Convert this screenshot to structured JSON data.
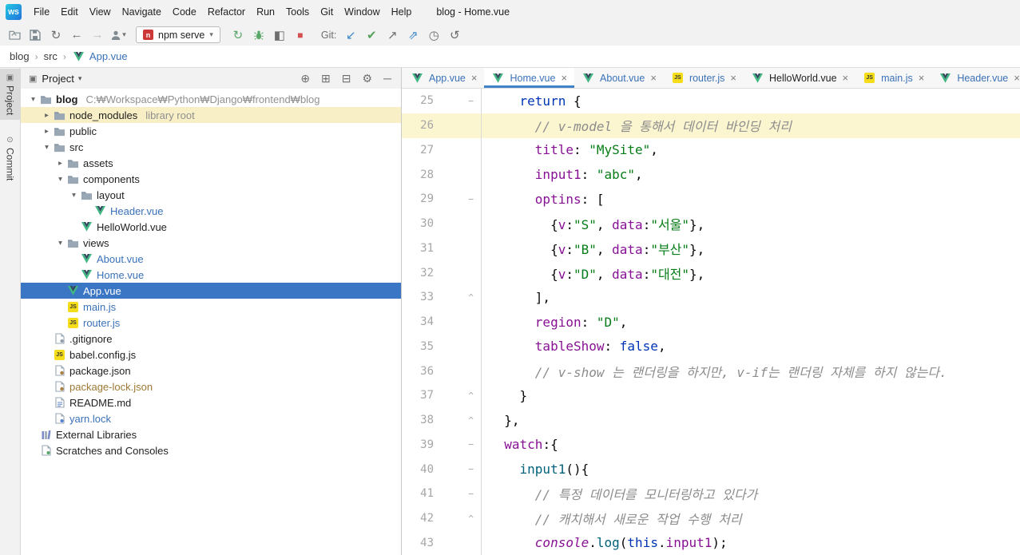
{
  "window": {
    "logo": "WS",
    "title": "blog - Home.vue"
  },
  "menu": {
    "items": [
      "File",
      "Edit",
      "View",
      "Navigate",
      "Code",
      "Refactor",
      "Run",
      "Tools",
      "Git",
      "Window",
      "Help"
    ]
  },
  "toolbar": {
    "run_config": "npm serve",
    "git_label": "Git:"
  },
  "icons": {
    "sync": "↻",
    "back": "←",
    "forward": "→",
    "dropdown": "▾",
    "npm": "n",
    "rerun": "↻",
    "profile": "◧",
    "stop": "■",
    "git_update": "↙",
    "git_commit": "✔",
    "git_push": "↗",
    "git_shelve": "⇗",
    "git_history": "◷",
    "git_rollback": "↺",
    "panel_icon": "▣",
    "commit_node": "⊙",
    "locate": "⊕",
    "expand_all": "⊞",
    "collapse_all": "⊟",
    "settings": "⚙",
    "hide": "─",
    "chevron_open": "▾",
    "chevron_closed": "▸",
    "breadcrumb_sep": "›",
    "tab_close": "×",
    "fold_start": "−",
    "fold_end": "^"
  },
  "breadcrumb": {
    "items": [
      {
        "label": "blog"
      },
      {
        "label": "src"
      },
      {
        "label": "App.vue",
        "icon": "vue",
        "modified": true
      }
    ]
  },
  "tool_strip": {
    "project": "Project",
    "commit": "Commit"
  },
  "project_panel": {
    "title": "Project",
    "tree": [
      {
        "label": "blog",
        "annotation": "C:₩Workspace₩Python₩Django₩frontend₩blog",
        "icon": "folder",
        "depth": 0,
        "chevron": "open",
        "bold": true
      },
      {
        "label": "node_modules",
        "annotation": "library root",
        "icon": "folder",
        "depth": 1,
        "chevron": "closed",
        "rowbg": "excluded"
      },
      {
        "label": "public",
        "icon": "folder",
        "depth": 1,
        "chevron": "closed"
      },
      {
        "label": "src",
        "icon": "folder",
        "depth": 1,
        "chevron": "open"
      },
      {
        "label": "assets",
        "icon": "folder",
        "depth": 2,
        "chevron": "closed"
      },
      {
        "label": "components",
        "icon": "folder",
        "depth": 2,
        "chevron": "open"
      },
      {
        "label": "layout",
        "icon": "folder",
        "depth": 3,
        "chevron": "open"
      },
      {
        "label": "Header.vue",
        "icon": "vue",
        "depth": 4,
        "color": "modified"
      },
      {
        "label": "HelloWorld.vue",
        "icon": "vue",
        "depth": 3
      },
      {
        "label": "views",
        "icon": "folder",
        "depth": 2,
        "chevron": "open"
      },
      {
        "label": "About.vue",
        "icon": "vue",
        "depth": 3,
        "color": "modified"
      },
      {
        "label": "Home.vue",
        "icon": "vue",
        "depth": 3,
        "color": "modified"
      },
      {
        "label": "App.vue",
        "icon": "vue",
        "depth": 2,
        "selected": true
      },
      {
        "label": "main.js",
        "icon": "js",
        "depth": 2,
        "color": "modified"
      },
      {
        "label": "router.js",
        "icon": "js",
        "depth": 2,
        "color": "modified"
      },
      {
        "label": ".gitignore",
        "icon": "gitfile",
        "depth": 1
      },
      {
        "label": "babel.config.js",
        "icon": "js",
        "depth": 1
      },
      {
        "label": "package.json",
        "icon": "json",
        "depth": 1
      },
      {
        "label": "package-lock.json",
        "icon": "json",
        "depth": 1,
        "color": "ignored"
      },
      {
        "label": "README.md",
        "icon": "md",
        "depth": 1
      },
      {
        "label": "yarn.lock",
        "icon": "lock",
        "depth": 1,
        "color": "modified"
      },
      {
        "label": "External Libraries",
        "icon": "lib",
        "depth": 0
      },
      {
        "label": "Scratches and Consoles",
        "icon": "scratch",
        "depth": 0
      }
    ]
  },
  "editor": {
    "tabs": [
      {
        "label": "App.vue",
        "icon": "vue",
        "modified": true
      },
      {
        "label": "Home.vue",
        "icon": "vue",
        "modified": true,
        "selected": true
      },
      {
        "label": "About.vue",
        "icon": "vue",
        "modified": true
      },
      {
        "label": "router.js",
        "icon": "js",
        "modified": true
      },
      {
        "label": "HelloWorld.vue",
        "icon": "vue"
      },
      {
        "label": "main.js",
        "icon": "js",
        "modified": true
      },
      {
        "label": "Header.vue",
        "icon": "vue",
        "modified": true
      }
    ],
    "lines": [
      {
        "num": 25,
        "fold": "start",
        "tokens": [
          [
            "pl",
            "    "
          ],
          [
            "kw",
            "return"
          ],
          [
            "pl",
            " {"
          ]
        ]
      },
      {
        "num": 26,
        "current": true,
        "tokens": [
          [
            "pl",
            "      "
          ],
          [
            "cm",
            "// v-model 을 통해서 데이터 바인딩 처리"
          ]
        ]
      },
      {
        "num": 27,
        "tokens": [
          [
            "pl",
            "      "
          ],
          [
            "pr",
            "title"
          ],
          [
            "pl",
            ": "
          ],
          [
            "st",
            "\"MySite\""
          ],
          [
            "pl",
            ","
          ]
        ]
      },
      {
        "num": 28,
        "tokens": [
          [
            "pl",
            "      "
          ],
          [
            "pr",
            "input1"
          ],
          [
            "pl",
            ": "
          ],
          [
            "st",
            "\"abc\""
          ],
          [
            "pl",
            ","
          ]
        ]
      },
      {
        "num": 29,
        "fold": "start",
        "tokens": [
          [
            "pl",
            "      "
          ],
          [
            "pr",
            "optins"
          ],
          [
            "pl",
            ": ["
          ]
        ]
      },
      {
        "num": 30,
        "tokens": [
          [
            "pl",
            "        {"
          ],
          [
            "pr",
            "v"
          ],
          [
            "pl",
            ":"
          ],
          [
            "st",
            "\"S\""
          ],
          [
            "pl",
            ", "
          ],
          [
            "pr",
            "data"
          ],
          [
            "pl",
            ":"
          ],
          [
            "st",
            "\"서울\""
          ],
          [
            "pl",
            "},"
          ]
        ]
      },
      {
        "num": 31,
        "tokens": [
          [
            "pl",
            "        {"
          ],
          [
            "pr",
            "v"
          ],
          [
            "pl",
            ":"
          ],
          [
            "st",
            "\"B\""
          ],
          [
            "pl",
            ", "
          ],
          [
            "pr",
            "data"
          ],
          [
            "pl",
            ":"
          ],
          [
            "st",
            "\"부산\""
          ],
          [
            "pl",
            "},"
          ]
        ]
      },
      {
        "num": 32,
        "tokens": [
          [
            "pl",
            "        {"
          ],
          [
            "pr",
            "v"
          ],
          [
            "pl",
            ":"
          ],
          [
            "st",
            "\"D\""
          ],
          [
            "pl",
            ", "
          ],
          [
            "pr",
            "data"
          ],
          [
            "pl",
            ":"
          ],
          [
            "st",
            "\"대전\""
          ],
          [
            "pl",
            "},"
          ]
        ]
      },
      {
        "num": 33,
        "fold": "end",
        "tokens": [
          [
            "pl",
            "      ],"
          ]
        ]
      },
      {
        "num": 34,
        "tokens": [
          [
            "pl",
            "      "
          ],
          [
            "pr",
            "region"
          ],
          [
            "pl",
            ": "
          ],
          [
            "st",
            "\"D\""
          ],
          [
            "pl",
            ","
          ]
        ]
      },
      {
        "num": 35,
        "tokens": [
          [
            "pl",
            "      "
          ],
          [
            "pr",
            "tableShow"
          ],
          [
            "pl",
            ": "
          ],
          [
            "kw",
            "false"
          ],
          [
            "pl",
            ","
          ]
        ]
      },
      {
        "num": 36,
        "tokens": [
          [
            "pl",
            "      "
          ],
          [
            "cm",
            "// v-show 는 랜더링을 하지만, v-if는 랜더링 자체를 하지 않는다."
          ]
        ]
      },
      {
        "num": 37,
        "fold": "end",
        "tokens": [
          [
            "pl",
            "    }"
          ]
        ]
      },
      {
        "num": 38,
        "fold": "end",
        "tokens": [
          [
            "pl",
            "  },"
          ]
        ]
      },
      {
        "num": 39,
        "fold": "start",
        "tokens": [
          [
            "pl",
            "  "
          ],
          [
            "pr",
            "watch"
          ],
          [
            "pl",
            ":{"
          ]
        ]
      },
      {
        "num": 40,
        "fold": "start",
        "tokens": [
          [
            "pl",
            "    "
          ],
          [
            "fn",
            "input1"
          ],
          [
            "pl",
            "(){"
          ]
        ]
      },
      {
        "num": 41,
        "fold": "start",
        "tokens": [
          [
            "pl",
            "      "
          ],
          [
            "cm",
            "// 특정 데이터를 모니터링하고 있다가"
          ]
        ]
      },
      {
        "num": 42,
        "fold": "end",
        "tokens": [
          [
            "pl",
            "      "
          ],
          [
            "cm",
            "// 캐치해서 새로운 작업 수행 처리"
          ]
        ]
      },
      {
        "num": 43,
        "tokens": [
          [
            "pl",
            "      "
          ],
          [
            "gv",
            "console"
          ],
          [
            "pl",
            "."
          ],
          [
            "fn",
            "log"
          ],
          [
            "pl",
            "("
          ],
          [
            "kw",
            "this"
          ],
          [
            "pl",
            "."
          ],
          [
            "pr",
            "input1"
          ],
          [
            "pl",
            ");"
          ]
        ]
      }
    ]
  },
  "colors": {
    "selection": "#3b76c5",
    "modified_file": "#3a71b8",
    "ignored_file": "#9c7a35",
    "current_line": "#fbf5d0",
    "excluded_row": "#f8efc6",
    "tab_underline": "#4083c9",
    "keyword": "#0033b3",
    "string": "#067d17",
    "comment": "#8c8c8c",
    "property": "#871094"
  }
}
